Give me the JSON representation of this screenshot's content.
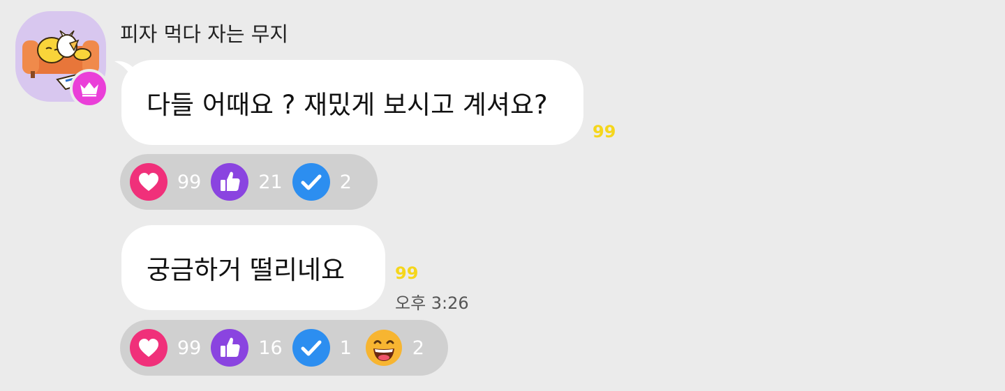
{
  "sender": {
    "name": "피자 먹다 자는 무지"
  },
  "messages": [
    {
      "text": "다들 어때요 ? 재밌게 보시고 계셔요?",
      "unread": "99",
      "reactions": [
        {
          "icon": "heart-icon",
          "count": "99",
          "color": "#f0307a"
        },
        {
          "icon": "thumbs-up-icon",
          "count": "21",
          "color": "#8a44e0"
        },
        {
          "icon": "check-icon",
          "count": "2",
          "color": "#2c8ef0"
        }
      ]
    },
    {
      "text": "궁금하거 떨리네요",
      "unread": "99",
      "time": "오후 3:26",
      "reactions": [
        {
          "icon": "heart-icon",
          "count": "99",
          "color": "#f0307a"
        },
        {
          "icon": "thumbs-up-icon",
          "count": "16",
          "color": "#8a44e0"
        },
        {
          "icon": "check-icon",
          "count": "1",
          "color": "#2c8ef0"
        },
        {
          "icon": "laughing-face-icon",
          "count": "2",
          "color": "#f7b531"
        }
      ]
    }
  ],
  "colors": {
    "background": "#ebebeb",
    "bubble": "#ffffff",
    "unread": "#f5d61c",
    "reaction_bar": "#d0d0d0",
    "crown_badge": "#ea3fd8"
  }
}
